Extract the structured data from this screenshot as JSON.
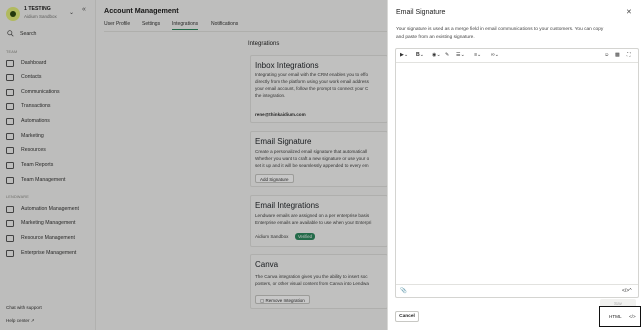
{
  "sidebar": {
    "org_name": "1 TESTING",
    "org_sub": "Aidium Sandbox",
    "search_label": "Search",
    "team_label": "TEAM",
    "team_items": [
      "Dashboard",
      "Contacts",
      "Communications",
      "Transactions",
      "Automations",
      "Marketing",
      "Resources",
      "Team Reports",
      "Team Management"
    ],
    "lendware_label": "LENDWARE",
    "lendware_items": [
      "Automation Management",
      "Marketing Management",
      "Resource Management",
      "Enterprise Management"
    ],
    "chat_support": "Chat with support",
    "help_center": "Help center"
  },
  "main": {
    "title": "Account Management",
    "tabs": [
      "User Profile",
      "Settings",
      "Integrations",
      "Notifications"
    ],
    "active_tab": "Integrations",
    "section_title": "Integrations",
    "cards": {
      "inbox": {
        "title": "Inbox Integrations",
        "desc": [
          "Integrating your email with the CRM enables you to effo",
          "directly from the platform using your work email address",
          "your email account, follow the prompt to connect your C",
          "the integration."
        ],
        "email": "rene@thinkaidium.com"
      },
      "signature": {
        "title": "Email Signature",
        "desc": [
          "Create a personalized email signature that automaticall",
          "Whether you want to craft a new signature or use your o",
          "set it up and it will be seamlessly appended to every em"
        ],
        "button": "Add Signature"
      },
      "email_int": {
        "title": "Email Integrations",
        "desc": [
          "Lendware emails are assigned on a per enterprise basis",
          "Enterprise emails are available to use when your Enterpri"
        ],
        "account": "Aidium Sandbox",
        "badge": "Verified"
      },
      "canva": {
        "title": "Canva",
        "desc": [
          "The Canva integration gives you the ability to insert soc",
          "posters, or other visual content from Canva into Lendwa"
        ],
        "button": "Remove Integration"
      }
    }
  },
  "panel": {
    "title": "Email Signature",
    "desc": [
      "Your signature is used as a merge field in email communications to your customers. You can copy",
      "and paste from an existing signature."
    ],
    "cancel": "Cancel",
    "save": "Sav",
    "html_label": "HTML",
    "code_glyph": "</>",
    "code_glyph_foot": "</>^"
  },
  "colors": {
    "accent": "#2f8a5f",
    "overlay": "rgba(0,0,0,0.22)"
  }
}
